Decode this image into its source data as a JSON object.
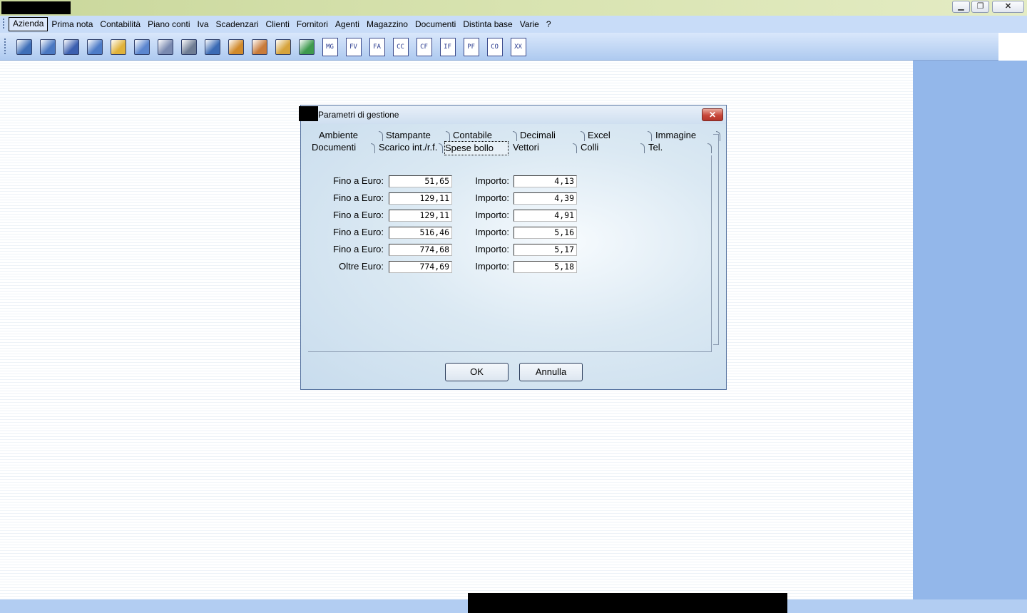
{
  "window": {
    "minimize_glyph": "▁",
    "maximize_glyph": "❐",
    "close_glyph": "✕"
  },
  "menu": {
    "items": [
      "Azienda",
      "Prima nota",
      "Contabilità",
      "Piano conti",
      "Iva",
      "Scadenzari",
      "Clienti",
      "Fornitori",
      "Agenti",
      "Magazzino",
      "Documenti",
      "Distinta base",
      "Varie",
      "?"
    ],
    "active": "Azienda"
  },
  "toolbar": {
    "icons": [
      {
        "name": "exit-door-icon",
        "color": "#3f6fb8"
      },
      {
        "name": "windows-icon",
        "color": "#4a78c2"
      },
      {
        "name": "calculator-icon",
        "color": "#3b5fb0"
      },
      {
        "name": "table-grid-icon",
        "color": "#4d7cc8"
      },
      {
        "name": "notepad-pencil-icon",
        "color": "#e0b23a"
      },
      {
        "name": "calendar-icon",
        "color": "#5b86cf"
      },
      {
        "name": "address-book-icon",
        "color": "#7a8ab0"
      },
      {
        "name": "tools-icon",
        "color": "#6f7d94"
      },
      {
        "name": "tree-structure-icon",
        "color": "#3b6bb5"
      },
      {
        "name": "card-file-icon",
        "color": "#d18a2a"
      },
      {
        "name": "contact-card-icon",
        "color": "#c97b3a"
      },
      {
        "name": "box-icon",
        "color": "#d6a33c"
      },
      {
        "name": "spreadsheet-icon",
        "color": "#3e9a4e"
      }
    ],
    "text_icons": [
      "MG",
      "FV",
      "FA",
      "CC",
      "CF",
      "IF",
      "PF",
      "CO",
      "XX"
    ]
  },
  "dialog": {
    "title": "Parametri di gestione",
    "close_glyph": "✕",
    "tabs_row1": [
      "Ambiente",
      "Stampante",
      "Contabile",
      "Decimali",
      "Excel",
      "Immagine"
    ],
    "tabs_row2": [
      "Documenti",
      "Scarico int./r.f.",
      "Spese bollo",
      "Vettori",
      "Colli",
      "Tel."
    ],
    "selected_tab": "Spese bollo",
    "rows": [
      {
        "label": "Fino a Euro:",
        "value": "51,65",
        "importo_label": "Importo:",
        "importo": "4,13"
      },
      {
        "label": "Fino a Euro:",
        "value": "129,11",
        "importo_label": "Importo:",
        "importo": "4,39"
      },
      {
        "label": "Fino a Euro:",
        "value": "129,11",
        "importo_label": "Importo:",
        "importo": "4,91"
      },
      {
        "label": "Fino a Euro:",
        "value": "516,46",
        "importo_label": "Importo:",
        "importo": "5,16"
      },
      {
        "label": "Fino a Euro:",
        "value": "774,68",
        "importo_label": "Importo:",
        "importo": "5,17"
      },
      {
        "label": "Oltre Euro:",
        "value": "774,69",
        "importo_label": "Importo:",
        "importo": "5,18"
      }
    ],
    "ok_label": "OK",
    "cancel_label": "Annulla"
  }
}
